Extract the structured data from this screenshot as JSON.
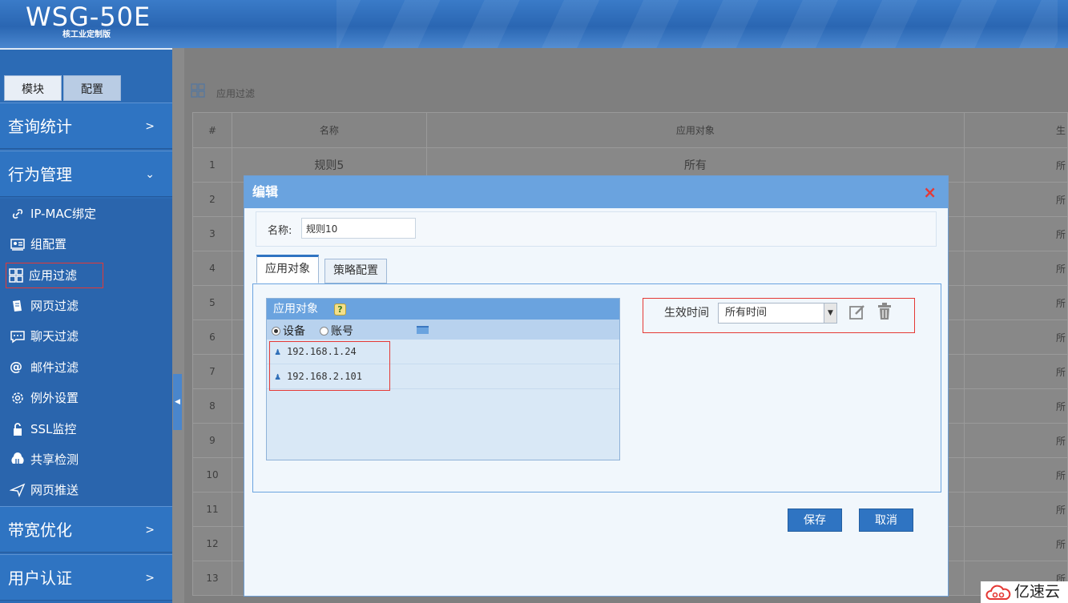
{
  "header": {
    "logo": "WSG-50E",
    "subtitle": "核工业定制版"
  },
  "sidebar": {
    "tabs": [
      "模块",
      "配置"
    ],
    "groups": {
      "query": "查询统计",
      "behavior": "行为管理",
      "bandwidth": "带宽优化",
      "auth": "用户认证"
    },
    "behavior_items": [
      {
        "label": "IP-MAC绑定",
        "icon": "link-icon"
      },
      {
        "label": "组配置",
        "icon": "id-card-icon"
      },
      {
        "label": "应用过滤",
        "icon": "grid-icon"
      },
      {
        "label": "网页过滤",
        "icon": "page-icon"
      },
      {
        "label": "聊天过滤",
        "icon": "chat-icon"
      },
      {
        "label": "邮件过滤",
        "icon": "at-icon"
      },
      {
        "label": "例外设置",
        "icon": "gear-icon"
      },
      {
        "label": "SSL监控",
        "icon": "lock-icon"
      },
      {
        "label": "共享检测",
        "icon": "share-icon"
      },
      {
        "label": "网页推送",
        "icon": "send-icon"
      }
    ]
  },
  "breadcrumb": "应用过滤",
  "table": {
    "headers": [
      "#",
      "名称",
      "应用对象",
      "生"
    ],
    "rows": [
      {
        "num": "1",
        "name": "规则5",
        "obj": "所有",
        "extra": "所"
      },
      {
        "num": "2",
        "name": "",
        "obj": "",
        "extra": "所"
      },
      {
        "num": "3",
        "name": "",
        "obj": "",
        "extra": "所"
      },
      {
        "num": "4",
        "name": "",
        "obj": "",
        "extra": "所"
      },
      {
        "num": "5",
        "name": "",
        "obj": "",
        "extra": "所"
      },
      {
        "num": "6",
        "name": "",
        "obj": "",
        "extra": "所"
      },
      {
        "num": "7",
        "name": "",
        "obj": "",
        "extra": "所"
      },
      {
        "num": "8",
        "name": "",
        "obj": "",
        "extra": "所"
      },
      {
        "num": "9",
        "name": "",
        "obj": "",
        "extra": "所"
      },
      {
        "num": "10",
        "name": "",
        "obj": "",
        "extra": "所"
      },
      {
        "num": "11",
        "name": "",
        "obj": "",
        "extra": "所"
      },
      {
        "num": "12",
        "name": "",
        "obj": "",
        "extra": "所"
      },
      {
        "num": "13",
        "name": "",
        "obj": "",
        "extra": "所"
      }
    ]
  },
  "modal": {
    "title": "编辑",
    "close": "×",
    "name_label": "名称:",
    "name_value": "规则10",
    "tabs": [
      "应用对象",
      "策略配置"
    ],
    "object_panel": {
      "title": "应用对象",
      "help": "?",
      "radio_device": "设备",
      "radio_account": "账号",
      "ips": [
        "192.168.1.24",
        "192.168.2.101"
      ]
    },
    "time_label": "生效时间",
    "time_value": "所有时间",
    "save": "保存",
    "cancel": "取消"
  },
  "watermark": "亿速云"
}
